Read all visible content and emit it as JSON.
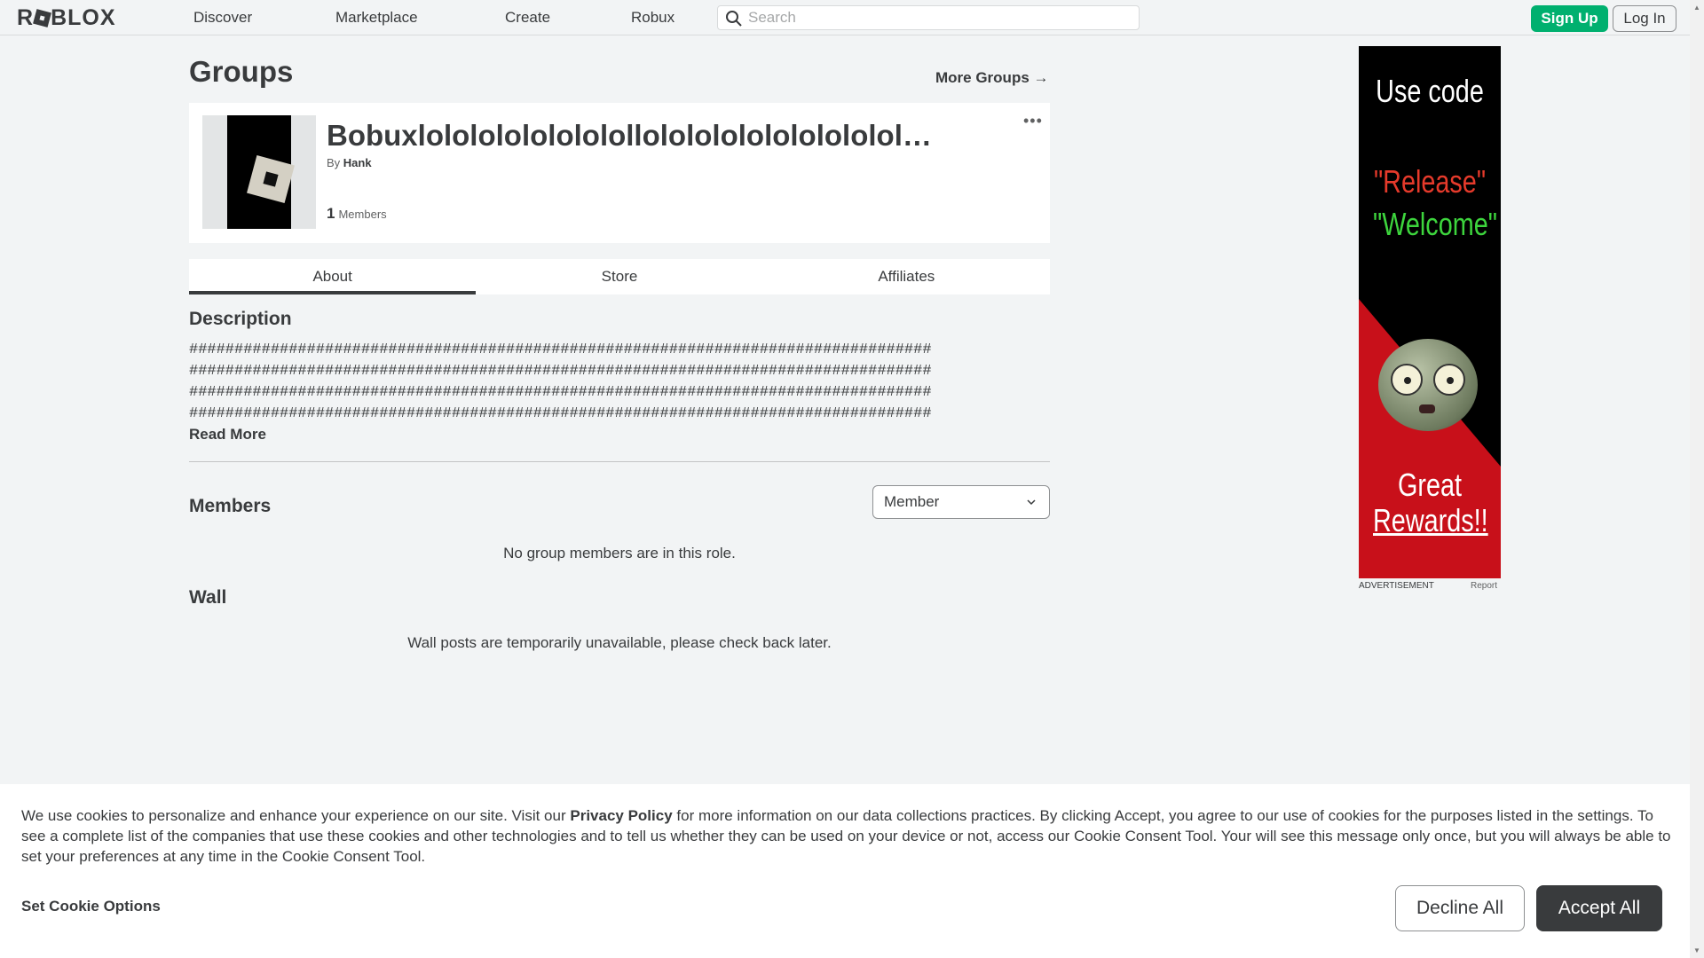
{
  "header": {
    "logo": "ROBLOX",
    "nav": [
      "Discover",
      "Marketplace",
      "Create",
      "Robux"
    ],
    "search_placeholder": "Search",
    "signup_label": "Sign Up",
    "login_label": "Log In"
  },
  "page": {
    "title": "Groups",
    "more_groups": "More Groups →"
  },
  "group": {
    "name": "Bobuxlolololololololollolololololololololol…",
    "by_prefix": "By",
    "owner": "Hank",
    "member_count": "1",
    "member_label": "Members",
    "more_menu": "•••"
  },
  "tabs": [
    {
      "label": "About",
      "active": true
    },
    {
      "label": "Store",
      "active": false
    },
    {
      "label": "Affiliates",
      "active": false
    }
  ],
  "description": {
    "title": "Description",
    "lines": [
      "##################################################################################",
      "##################################################################################",
      "##################################################################################",
      "##################################################################################"
    ],
    "read_more": "Read More"
  },
  "members": {
    "title": "Members",
    "role_selected": "Member",
    "empty_message": "No group members are in this role."
  },
  "wall": {
    "title": "Wall",
    "message": "Wall posts are temporarily unavailable, please check back later."
  },
  "ad": {
    "line1": "Use code",
    "line2": "\"Release\"",
    "line3": "\"Welcome\"",
    "line4a": "Great",
    "line4b": "Rewards!!",
    "label": "ADVERTISEMENT",
    "report": "Report"
  },
  "cookie_banner": {
    "text_before": "We use cookies to personalize and enhance your experience on our site. Visit our ",
    "link": "Privacy Policy",
    "text_after": " for more information on our data collections practices. By clicking Accept, you agree to our use of cookies for the purposes listed in the settings. To see a complete list of the companies that use these cookies and other technologies and to tell us whether they can be used on your device or not, access our Cookie Consent Tool. Your will see this message only once, but you will always be able to set your preferences at any time in the Cookie Consent Tool.",
    "set_options": "Set Cookie Options",
    "decline": "Decline All",
    "accept": "Accept All"
  }
}
